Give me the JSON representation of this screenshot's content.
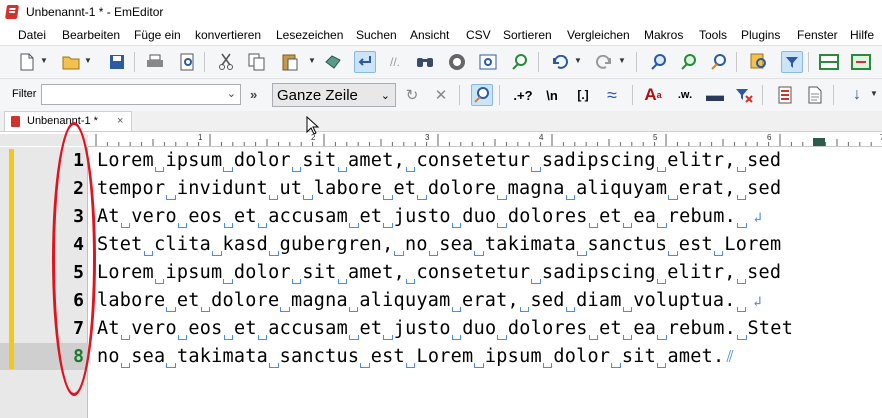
{
  "window": {
    "title": "Unbenannt-1 * - EmEditor"
  },
  "menu": [
    "Datei",
    "Bearbeiten",
    "Füge ein",
    "konvertieren",
    "Lesezeichen",
    "Suchen",
    "Ansicht",
    "CSV",
    "Sortieren",
    "Vergleichen",
    "Makros",
    "Tools",
    "Plugins",
    "Fenster",
    "Hilfe"
  ],
  "filter_bar": {
    "label": "Filter",
    "value": "",
    "mode": "Ganze Zeile"
  },
  "search_toolbar": {
    "regex_label": ".+?",
    "newline_label": "\\n",
    "brackets_label": "[.]",
    "count_label": ".w."
  },
  "tab": {
    "label": "Unbenannt-1 *",
    "close": "×"
  },
  "ruler": {
    "marks": [
      "1",
      "2",
      "3",
      "4",
      "5",
      "6",
      "7"
    ]
  },
  "editor": {
    "current_line": 8,
    "lines": [
      {
        "num": "1",
        "text": "Lorem ipsum dolor sit amet, consetetur sadipscing elitr, sed"
      },
      {
        "num": "2",
        "text": "tempor invidunt ut labore et dolore magna aliquyam erat, sed"
      },
      {
        "num": "3",
        "text": "At vero eos et accusam et justo duo dolores et ea rebum. "
      },
      {
        "num": "4",
        "text": "Stet clita kasd gubergren, no sea takimata sanctus est Lorem"
      },
      {
        "num": "5",
        "text": "Lorem ipsum dolor sit amet, consetetur sadipscing elitr, sed"
      },
      {
        "num": "6",
        "text": "labore et dolore magna aliquyam erat, sed diam voluptua. "
      },
      {
        "num": "7",
        "text": "At vero eos et accusam et justo duo dolores et ea rebum. Stet"
      },
      {
        "num": "8",
        "text": "no sea takimata sanctus est Lorem ipsum dolor sit amet."
      }
    ]
  },
  "colors": {
    "change_bar": "#f3c81a",
    "whitespace_mark": "#4a8fd8",
    "annotation": "#e0141e",
    "current_line_number": "#1e7a2c"
  },
  "icons": [
    "new-file-icon",
    "open-folder-icon",
    "save-icon",
    "print-icon",
    "print-preview-icon",
    "cut-icon",
    "copy-icon",
    "paste-icon",
    "wrap-icon",
    "find-icon",
    "replace-icon",
    "undo-icon",
    "redo-icon",
    "filter-icon"
  ]
}
